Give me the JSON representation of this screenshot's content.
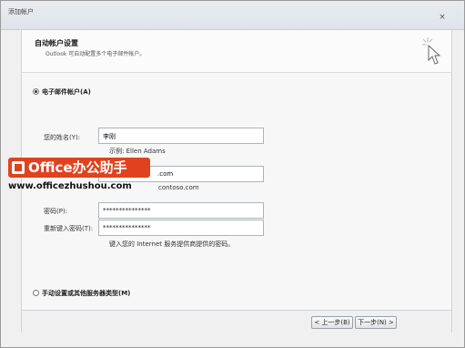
{
  "window": {
    "title": "添加帐户",
    "close_glyph": "×"
  },
  "header": {
    "title": "自动帐户设置",
    "subtitle": "Outlook 可自动配置多个电子邮件帐户。"
  },
  "options": {
    "email_account_label": "电子邮件帐户(A)",
    "manual_label": "手动设置或其他服务器类型(M)"
  },
  "form": {
    "name_label": "您的姓名(Y):",
    "name_value": "李刚",
    "name_hint": "示例: Ellen Adams",
    "email_value": ".com",
    "email_hint": "contoso.com",
    "password_label": "密码(P):",
    "password_value": "***************",
    "retype_label": "重新键入密码(T):",
    "retype_value": "***************",
    "password_hint": "键入您的 Internet 服务提供商提供的密码。"
  },
  "watermark": {
    "badge_text": "Office办公助手",
    "url": "www.officezhushou.com"
  },
  "buttons": {
    "back": "< 上一步(B)",
    "next": "下一步(N) >"
  }
}
